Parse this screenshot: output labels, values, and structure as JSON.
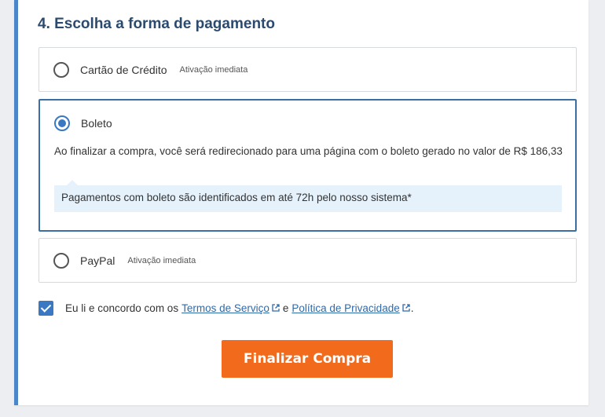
{
  "section": {
    "title": "4. Escolha a forma de pagamento"
  },
  "options": [
    {
      "label": "Cartão de Crédito",
      "tag": "Ativação imediata",
      "selected": false
    },
    {
      "label": "Boleto",
      "selected": true,
      "description": "Ao finalizar a compra, você será redirecionado para uma página com o boleto gerado no valor de R$ 186,33",
      "note": "Pagamentos com boleto são identificados em até 72h pelo nosso sistema*"
    },
    {
      "label": "PayPal",
      "tag": "Ativação imediata",
      "selected": false
    }
  ],
  "agreement": {
    "checked": true,
    "prefix": "Eu li e concordo com os",
    "terms_link": "Termos de Serviço",
    "conjunction": "e",
    "privacy_link": "Política de Privacidade",
    "suffix": "."
  },
  "submit": {
    "label": "Finalizar Compra"
  },
  "colors": {
    "accent": "#3a78c2",
    "title": "#2c4a6e",
    "button": "#f26b1d",
    "note_bg": "#e6f2fb"
  }
}
